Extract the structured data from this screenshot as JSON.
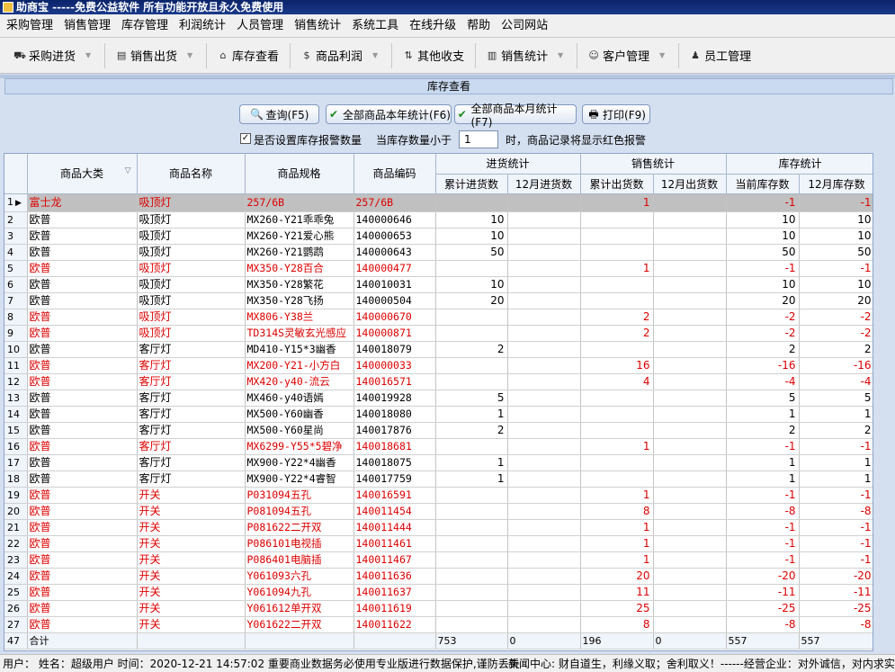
{
  "window": {
    "title": "助商宝 -----免费公益软件 所有功能开放且永久免费使用"
  },
  "menu": [
    "采购管理",
    "销售管理",
    "库存管理",
    "利润统计",
    "人员管理",
    "销售统计",
    "系统工具",
    "在线升级",
    "帮助",
    "公司网站"
  ],
  "toolbar": [
    {
      "label": "采购进货",
      "icon": "purchase-icon"
    },
    {
      "label": "销售出货",
      "icon": "sales-out-icon"
    },
    {
      "label": "库存查看",
      "icon": "warehouse-icon"
    },
    {
      "label": "商品利润",
      "icon": "profit-icon"
    },
    {
      "label": "其他收支",
      "icon": "income-expense-icon"
    },
    {
      "label": "销售统计",
      "icon": "chart-icon"
    },
    {
      "label": "客户管理",
      "icon": "customer-icon"
    },
    {
      "label": "员工管理",
      "icon": "staff-icon"
    }
  ],
  "panel": {
    "title": "库存查看"
  },
  "actions": {
    "query": "查询(F5)",
    "year_stats": "全部商品本年统计(F6)",
    "month_stats": "全部商品本月统计(F7)",
    "print": "打印(F9)"
  },
  "options": {
    "alarm_label": "是否设置库存报警数量",
    "alarm_checked": true,
    "threshold_prefix": "当库存数量小于",
    "threshold_value": "1",
    "threshold_suffix": "时，商品记录将显示红色报警"
  },
  "table": {
    "headers": {
      "category": "商品大类",
      "name": "商品名称",
      "spec": "商品规格",
      "code": "商品编码",
      "purchase_group": "进货统计",
      "sales_group": "销售统计",
      "stock_group": "库存统计",
      "purchase_total": "累计进货数",
      "purchase_month": "12月进货数",
      "sales_total": "累计出货数",
      "sales_month": "12月出货数",
      "stock_current": "当前库存数",
      "stock_month": "12月库存数"
    },
    "rows": [
      {
        "n": "1",
        "cat": "富士龙",
        "name": "吸顶灯",
        "spec": "257/6B",
        "code": "257/6B",
        "pin": "",
        "pmo": "",
        "sout": "1",
        "smo": "",
        "cur": "-1",
        "mon": "-1",
        "red": true,
        "sel": true
      },
      {
        "n": "2",
        "cat": "欧普",
        "name": "吸顶灯",
        "spec": "MX260-Y21乖乖兔",
        "code": "140000646",
        "pin": "10",
        "pmo": "",
        "sout": "",
        "smo": "",
        "cur": "10",
        "mon": "10",
        "red": false
      },
      {
        "n": "3",
        "cat": "欧普",
        "name": "吸顶灯",
        "spec": "MX260-Y21爱心熊",
        "code": "140000653",
        "pin": "10",
        "pmo": "",
        "sout": "",
        "smo": "",
        "cur": "10",
        "mon": "10",
        "red": false
      },
      {
        "n": "4",
        "cat": "欧普",
        "name": "吸顶灯",
        "spec": "MX260-Y21鹦鹉",
        "code": "140000643",
        "pin": "50",
        "pmo": "",
        "sout": "",
        "smo": "",
        "cur": "50",
        "mon": "50",
        "red": false
      },
      {
        "n": "5",
        "cat": "欧普",
        "name": "吸顶灯",
        "spec": "MX350-Y28百合",
        "code": "140000477",
        "pin": "",
        "pmo": "",
        "sout": "1",
        "smo": "",
        "cur": "-1",
        "mon": "-1",
        "red": true
      },
      {
        "n": "6",
        "cat": "欧普",
        "name": "吸顶灯",
        "spec": "MX350-Y28繁花",
        "code": "140010031",
        "pin": "10",
        "pmo": "",
        "sout": "",
        "smo": "",
        "cur": "10",
        "mon": "10",
        "red": false
      },
      {
        "n": "7",
        "cat": "欧普",
        "name": "吸顶灯",
        "spec": "MX350-Y28飞扬",
        "code": "140000504",
        "pin": "20",
        "pmo": "",
        "sout": "",
        "smo": "",
        "cur": "20",
        "mon": "20",
        "red": false
      },
      {
        "n": "8",
        "cat": "欧普",
        "name": "吸顶灯",
        "spec": "MX806-Y38兰",
        "code": "140000670",
        "pin": "",
        "pmo": "",
        "sout": "2",
        "smo": "",
        "cur": "-2",
        "mon": "-2",
        "red": true
      },
      {
        "n": "9",
        "cat": "欧普",
        "name": "吸顶灯",
        "spec": "TD314S灵敏玄光感应",
        "code": "140000871",
        "pin": "",
        "pmo": "",
        "sout": "2",
        "smo": "",
        "cur": "-2",
        "mon": "-2",
        "red": true
      },
      {
        "n": "10",
        "cat": "欧普",
        "name": "客厅灯",
        "spec": "MD410-Y15*3幽香",
        "code": "140018079",
        "pin": "2",
        "pmo": "",
        "sout": "",
        "smo": "",
        "cur": "2",
        "mon": "2",
        "red": false
      },
      {
        "n": "11",
        "cat": "欧普",
        "name": "客厅灯",
        "spec": "MX200-Y21-小方白",
        "code": "140000033",
        "pin": "",
        "pmo": "",
        "sout": "16",
        "smo": "",
        "cur": "-16",
        "mon": "-16",
        "red": true
      },
      {
        "n": "12",
        "cat": "欧普",
        "name": "客厅灯",
        "spec": "MX420-y40-流云",
        "code": "140016571",
        "pin": "",
        "pmo": "",
        "sout": "4",
        "smo": "",
        "cur": "-4",
        "mon": "-4",
        "red": true
      },
      {
        "n": "13",
        "cat": "欧普",
        "name": "客厅灯",
        "spec": "MX460-y40语嫣",
        "code": "140019928",
        "pin": "5",
        "pmo": "",
        "sout": "",
        "smo": "",
        "cur": "5",
        "mon": "5",
        "red": false
      },
      {
        "n": "14",
        "cat": "欧普",
        "name": "客厅灯",
        "spec": "MX500-Y60幽香",
        "code": "140018080",
        "pin": "1",
        "pmo": "",
        "sout": "",
        "smo": "",
        "cur": "1",
        "mon": "1",
        "red": false
      },
      {
        "n": "15",
        "cat": "欧普",
        "name": "客厅灯",
        "spec": "MX500-Y60星尚",
        "code": "140017876",
        "pin": "2",
        "pmo": "",
        "sout": "",
        "smo": "",
        "cur": "2",
        "mon": "2",
        "red": false
      },
      {
        "n": "16",
        "cat": "欧普",
        "name": "客厅灯",
        "spec": "MX6299-Y55*5碧净",
        "code": "140018681",
        "pin": "",
        "pmo": "",
        "sout": "1",
        "smo": "",
        "cur": "-1",
        "mon": "-1",
        "red": true
      },
      {
        "n": "17",
        "cat": "欧普",
        "name": "客厅灯",
        "spec": "MX900-Y22*4幽香",
        "code": "140018075",
        "pin": "1",
        "pmo": "",
        "sout": "",
        "smo": "",
        "cur": "1",
        "mon": "1",
        "red": false
      },
      {
        "n": "18",
        "cat": "欧普",
        "name": "客厅灯",
        "spec": "MX900-Y22*4睿智",
        "code": "140017759",
        "pin": "1",
        "pmo": "",
        "sout": "",
        "smo": "",
        "cur": "1",
        "mon": "1",
        "red": false
      },
      {
        "n": "19",
        "cat": "欧普",
        "name": "开关",
        "spec": "P031094五孔",
        "code": "140016591",
        "pin": "",
        "pmo": "",
        "sout": "1",
        "smo": "",
        "cur": "-1",
        "mon": "-1",
        "red": true
      },
      {
        "n": "20",
        "cat": "欧普",
        "name": "开关",
        "spec": "P081094五孔",
        "code": "140011454",
        "pin": "",
        "pmo": "",
        "sout": "8",
        "smo": "",
        "cur": "-8",
        "mon": "-8",
        "red": true
      },
      {
        "n": "21",
        "cat": "欧普",
        "name": "开关",
        "spec": "P081622二开双",
        "code": "140011444",
        "pin": "",
        "pmo": "",
        "sout": "1",
        "smo": "",
        "cur": "-1",
        "mon": "-1",
        "red": true
      },
      {
        "n": "22",
        "cat": "欧普",
        "name": "开关",
        "spec": "P086101电视插",
        "code": "140011461",
        "pin": "",
        "pmo": "",
        "sout": "1",
        "smo": "",
        "cur": "-1",
        "mon": "-1",
        "red": true
      },
      {
        "n": "23",
        "cat": "欧普",
        "name": "开关",
        "spec": "P086401电脑插",
        "code": "140011467",
        "pin": "",
        "pmo": "",
        "sout": "1",
        "smo": "",
        "cur": "-1",
        "mon": "-1",
        "red": true
      },
      {
        "n": "24",
        "cat": "欧普",
        "name": "开关",
        "spec": "Y061093六孔",
        "code": "140011636",
        "pin": "",
        "pmo": "",
        "sout": "20",
        "smo": "",
        "cur": "-20",
        "mon": "-20",
        "red": true
      },
      {
        "n": "25",
        "cat": "欧普",
        "name": "开关",
        "spec": "Y061094九孔",
        "code": "140011637",
        "pin": "",
        "pmo": "",
        "sout": "11",
        "smo": "",
        "cur": "-11",
        "mon": "-11",
        "red": true
      },
      {
        "n": "26",
        "cat": "欧普",
        "name": "开关",
        "spec": "Y061612单开双",
        "code": "140011619",
        "pin": "",
        "pmo": "",
        "sout": "25",
        "smo": "",
        "cur": "-25",
        "mon": "-25",
        "red": true
      },
      {
        "n": "27",
        "cat": "欧普",
        "name": "开关",
        "spec": "Y061622二开双",
        "code": "140011622",
        "pin": "",
        "pmo": "",
        "sout": "8",
        "smo": "",
        "cur": "-8",
        "mon": "-8",
        "red": true
      }
    ],
    "footer": {
      "n": "47",
      "label": "合计",
      "pin": "753",
      "pmo": "0",
      "sout": "196",
      "smo": "0",
      "cur": "557",
      "mon": "557"
    }
  },
  "status": {
    "user": "用户： 姓名：超级用户 时间：2020-12-21 14:57:02 重要商业数据务必使用专业版进行数据保护,谨防丢失",
    "news": "新闻中心: 财自道生，利缘义取；舍利取义！------经营企业：对外诚信，对内求实。"
  },
  "colors": {
    "alarm_red": "#dd0000",
    "title_bar": "#0a246a",
    "panel_bg": "#d4dff0",
    "selected_row": "#c0c0c0"
  }
}
